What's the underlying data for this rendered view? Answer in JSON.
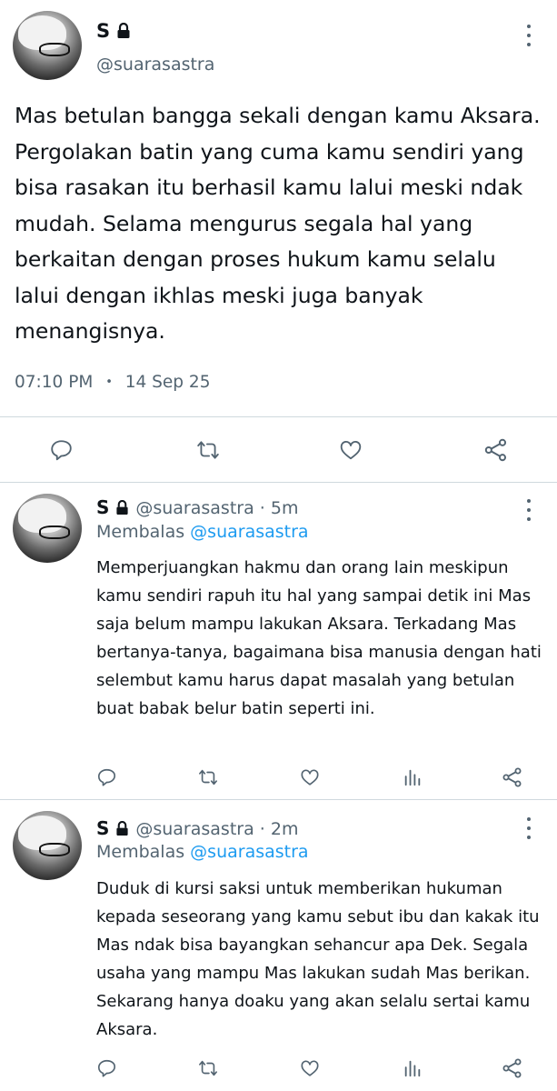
{
  "main_tweet": {
    "display_name": "S",
    "handle": "@suarasastra",
    "text": "Mas betulan bangga sekali dengan kamu Aksara. Pergolakan batin yang cuma kamu sendiri yang bisa rasakan itu berhasil kamu lalui meski ndak mudah. Selama mengurus segala hal yang berkaitan dengan proses hukum kamu selalu lalui dengan ikhlas meski juga banyak menangisnya.",
    "time": "07:10 PM",
    "date": "14 Sep 25",
    "separator": "•"
  },
  "replies": [
    {
      "display_name": "S",
      "handle": "@suarasastra",
      "age": "5m",
      "replying_prefix": "Membalas",
      "replying_to": "@suarasastra",
      "text": "Memperjuangkan hakmu dan orang lain meskipun kamu sendiri rapuh itu hal yang sampai detik ini Mas saja belum mampu lakukan Aksara. Terkadang Mas bertanya-tanya, bagaimana bisa manusia dengan hati selembut kamu harus dapat masalah yang betulan buat babak belur batin seperti ini."
    },
    {
      "display_name": "S",
      "handle": "@suarasastra",
      "age": "2m",
      "replying_prefix": "Membalas",
      "replying_to": "@suarasastra",
      "text": "Duduk di kursi saksi untuk memberikan hukuman kepada seseorang yang kamu sebut ibu dan kakak itu Mas ndak bisa bayangkan sehancur apa Dek. Segala usaha yang mampu Mas lakukan sudah Mas berikan. Sekarang hanya doaku yang akan selalu sertai kamu Aksara."
    }
  ],
  "dot_separator": "·",
  "icons": {
    "reply": "reply-icon",
    "retweet": "retweet-icon",
    "like": "like-icon",
    "share": "share-icon",
    "views": "views-icon",
    "more": "more-icon",
    "lock": "lock-icon"
  },
  "colors": {
    "text": "#0f1419",
    "muted": "#536471",
    "link": "#1d9bf0",
    "divider": "#cfd9de"
  }
}
